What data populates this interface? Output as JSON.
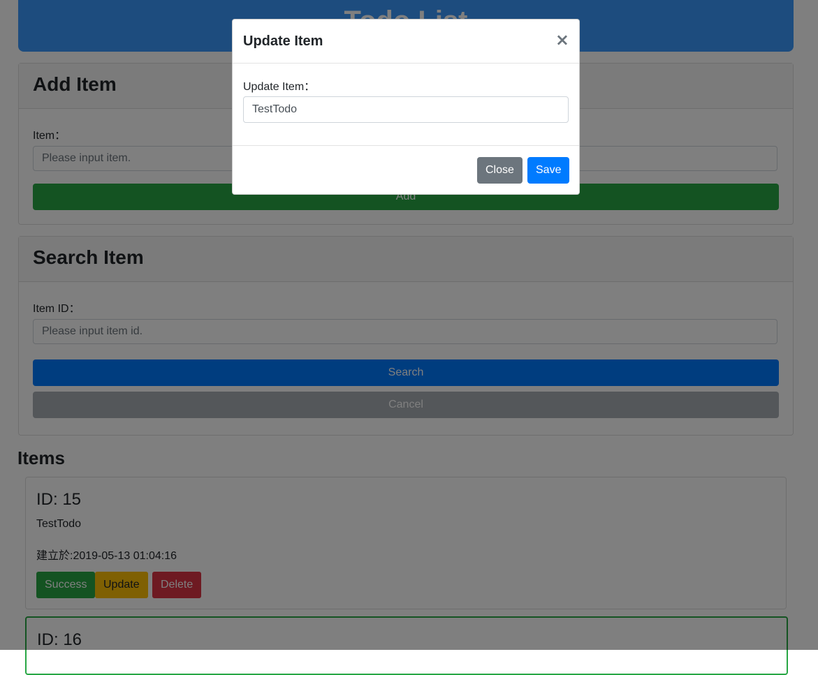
{
  "header": {
    "title": "Todo List"
  },
  "add_card": {
    "title": "Add Item",
    "label": "Item：",
    "placeholder": "Please input item.",
    "button": "Add"
  },
  "search_card": {
    "title": "Search Item",
    "label": "Item ID：",
    "placeholder": "Please input item id.",
    "search_button": "Search",
    "cancel_button": "Cancel"
  },
  "items": {
    "title": "Items",
    "list": [
      {
        "id_label": "ID: 15",
        "text": "TestTodo",
        "created": "建立於:2019-05-13 01:04:16",
        "success": "Success",
        "update": "Update",
        "delete": "Delete"
      },
      {
        "id_label": "ID: 16"
      }
    ]
  },
  "modal": {
    "title": "Update Item",
    "close_icon": "×",
    "label": "Update Item：",
    "value": "TestTodo",
    "close_button": "Close",
    "save_button": "Save"
  },
  "colors": {
    "primary": "#007bff",
    "secondary": "#6c757d",
    "success": "#28a745",
    "warning": "#ffc107",
    "danger": "#dc3545",
    "jumbotron": "#3a99fc"
  }
}
